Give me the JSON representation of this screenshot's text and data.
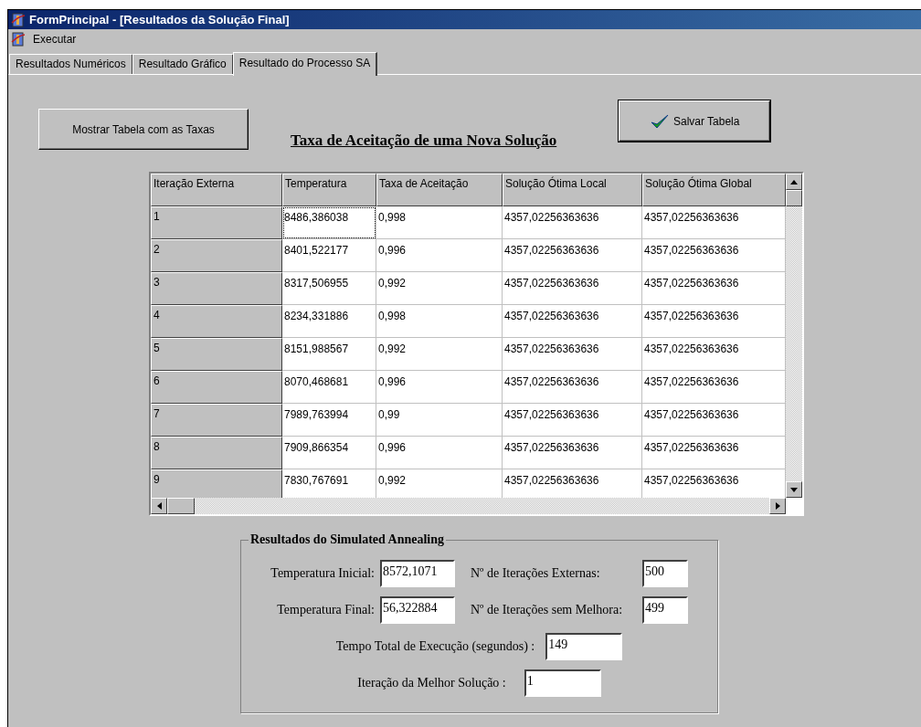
{
  "window": {
    "title": "FormPrincipal - [Resultados da Solução Final]"
  },
  "menu": [
    {
      "label": "Executar"
    }
  ],
  "tabs": [
    {
      "label": "Resultados Numéricos",
      "selected": false
    },
    {
      "label": "Resultado Gráfico",
      "selected": false
    },
    {
      "label": "Resultado do Processo SA",
      "selected": true
    }
  ],
  "show_button": "Mostrar Tabela com as Taxas",
  "heading": "Taxa de Aceitação de uma Nova Solução",
  "save_button": "Salvar Tabela",
  "table": {
    "columns": [
      "Iteração Externa",
      "Temperatura",
      "Taxa de Aceitação",
      "Solução Ótima Local",
      "Solução Ótima Global"
    ],
    "rows": [
      {
        "cells": [
          "1",
          "8486,386038",
          "0,998",
          "4357,02256363636",
          "4357,02256363636"
        ],
        "focused": true
      },
      {
        "cells": [
          "2",
          "8401,522177",
          "0,996",
          "4357,02256363636",
          "4357,02256363636"
        ],
        "focused": false
      },
      {
        "cells": [
          "3",
          "8317,506955",
          "0,992",
          "4357,02256363636",
          "4357,02256363636"
        ],
        "focused": false
      },
      {
        "cells": [
          "4",
          "8234,331886",
          "0,998",
          "4357,02256363636",
          "4357,02256363636"
        ],
        "focused": false
      },
      {
        "cells": [
          "5",
          "8151,988567",
          "0,992",
          "4357,02256363636",
          "4357,02256363636"
        ],
        "focused": false
      },
      {
        "cells": [
          "6",
          "8070,468681",
          "0,996",
          "4357,02256363636",
          "4357,02256363636"
        ],
        "focused": false
      },
      {
        "cells": [
          "7",
          "7989,763994",
          "0,99",
          "4357,02256363636",
          "4357,02256363636"
        ],
        "focused": false
      },
      {
        "cells": [
          "8",
          "7909,866354",
          "0,996",
          "4357,02256363636",
          "4357,02256363636"
        ],
        "focused": false
      },
      {
        "cells": [
          "9",
          "7830,767691",
          "0,992",
          "4357,02256363636",
          "4357,02256363636"
        ],
        "focused": false
      }
    ]
  },
  "results": {
    "title": "Resultados do Simulated Annealing",
    "initial_temperature": {
      "label": "Temperatura Inicial:",
      "value": "8572,1071"
    },
    "external_iterations": {
      "label": "Nº de Iterações Externas:",
      "value": "500"
    },
    "final_temperature": {
      "label": "Temperatura Final:",
      "value": "56,322884"
    },
    "iterations_without_improvement": {
      "label": "Nº de Iterações sem Melhora:",
      "value": "499"
    },
    "total_time": {
      "label": "Tempo Total de Execução (segundos) :",
      "value": "149"
    },
    "best_iteration": {
      "label": "Iteração da Melhor Solução :",
      "value": "1"
    }
  }
}
